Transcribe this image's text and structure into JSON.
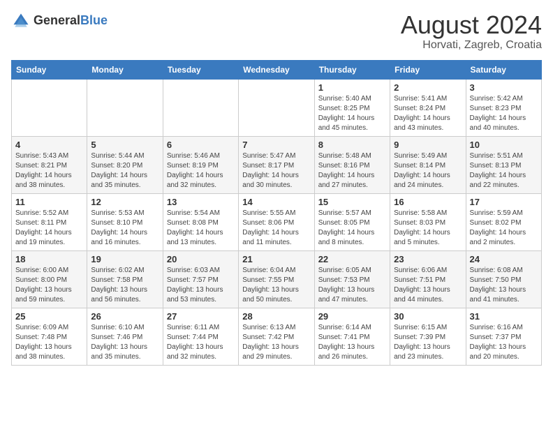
{
  "logo": {
    "general": "General",
    "blue": "Blue"
  },
  "title": "August 2024",
  "location": "Horvati, Zagreb, Croatia",
  "weekdays": [
    "Sunday",
    "Monday",
    "Tuesday",
    "Wednesday",
    "Thursday",
    "Friday",
    "Saturday"
  ],
  "weeks": [
    [
      {
        "day": "",
        "info": ""
      },
      {
        "day": "",
        "info": ""
      },
      {
        "day": "",
        "info": ""
      },
      {
        "day": "",
        "info": ""
      },
      {
        "day": "1",
        "info": "Sunrise: 5:40 AM\nSunset: 8:25 PM\nDaylight: 14 hours\nand 45 minutes."
      },
      {
        "day": "2",
        "info": "Sunrise: 5:41 AM\nSunset: 8:24 PM\nDaylight: 14 hours\nand 43 minutes."
      },
      {
        "day": "3",
        "info": "Sunrise: 5:42 AM\nSunset: 8:23 PM\nDaylight: 14 hours\nand 40 minutes."
      }
    ],
    [
      {
        "day": "4",
        "info": "Sunrise: 5:43 AM\nSunset: 8:21 PM\nDaylight: 14 hours\nand 38 minutes."
      },
      {
        "day": "5",
        "info": "Sunrise: 5:44 AM\nSunset: 8:20 PM\nDaylight: 14 hours\nand 35 minutes."
      },
      {
        "day": "6",
        "info": "Sunrise: 5:46 AM\nSunset: 8:19 PM\nDaylight: 14 hours\nand 32 minutes."
      },
      {
        "day": "7",
        "info": "Sunrise: 5:47 AM\nSunset: 8:17 PM\nDaylight: 14 hours\nand 30 minutes."
      },
      {
        "day": "8",
        "info": "Sunrise: 5:48 AM\nSunset: 8:16 PM\nDaylight: 14 hours\nand 27 minutes."
      },
      {
        "day": "9",
        "info": "Sunrise: 5:49 AM\nSunset: 8:14 PM\nDaylight: 14 hours\nand 24 minutes."
      },
      {
        "day": "10",
        "info": "Sunrise: 5:51 AM\nSunset: 8:13 PM\nDaylight: 14 hours\nand 22 minutes."
      }
    ],
    [
      {
        "day": "11",
        "info": "Sunrise: 5:52 AM\nSunset: 8:11 PM\nDaylight: 14 hours\nand 19 minutes."
      },
      {
        "day": "12",
        "info": "Sunrise: 5:53 AM\nSunset: 8:10 PM\nDaylight: 14 hours\nand 16 minutes."
      },
      {
        "day": "13",
        "info": "Sunrise: 5:54 AM\nSunset: 8:08 PM\nDaylight: 14 hours\nand 13 minutes."
      },
      {
        "day": "14",
        "info": "Sunrise: 5:55 AM\nSunset: 8:06 PM\nDaylight: 14 hours\nand 11 minutes."
      },
      {
        "day": "15",
        "info": "Sunrise: 5:57 AM\nSunset: 8:05 PM\nDaylight: 14 hours\nand 8 minutes."
      },
      {
        "day": "16",
        "info": "Sunrise: 5:58 AM\nSunset: 8:03 PM\nDaylight: 14 hours\nand 5 minutes."
      },
      {
        "day": "17",
        "info": "Sunrise: 5:59 AM\nSunset: 8:02 PM\nDaylight: 14 hours\nand 2 minutes."
      }
    ],
    [
      {
        "day": "18",
        "info": "Sunrise: 6:00 AM\nSunset: 8:00 PM\nDaylight: 13 hours\nand 59 minutes."
      },
      {
        "day": "19",
        "info": "Sunrise: 6:02 AM\nSunset: 7:58 PM\nDaylight: 13 hours\nand 56 minutes."
      },
      {
        "day": "20",
        "info": "Sunrise: 6:03 AM\nSunset: 7:57 PM\nDaylight: 13 hours\nand 53 minutes."
      },
      {
        "day": "21",
        "info": "Sunrise: 6:04 AM\nSunset: 7:55 PM\nDaylight: 13 hours\nand 50 minutes."
      },
      {
        "day": "22",
        "info": "Sunrise: 6:05 AM\nSunset: 7:53 PM\nDaylight: 13 hours\nand 47 minutes."
      },
      {
        "day": "23",
        "info": "Sunrise: 6:06 AM\nSunset: 7:51 PM\nDaylight: 13 hours\nand 44 minutes."
      },
      {
        "day": "24",
        "info": "Sunrise: 6:08 AM\nSunset: 7:50 PM\nDaylight: 13 hours\nand 41 minutes."
      }
    ],
    [
      {
        "day": "25",
        "info": "Sunrise: 6:09 AM\nSunset: 7:48 PM\nDaylight: 13 hours\nand 38 minutes."
      },
      {
        "day": "26",
        "info": "Sunrise: 6:10 AM\nSunset: 7:46 PM\nDaylight: 13 hours\nand 35 minutes."
      },
      {
        "day": "27",
        "info": "Sunrise: 6:11 AM\nSunset: 7:44 PM\nDaylight: 13 hours\nand 32 minutes."
      },
      {
        "day": "28",
        "info": "Sunrise: 6:13 AM\nSunset: 7:42 PM\nDaylight: 13 hours\nand 29 minutes."
      },
      {
        "day": "29",
        "info": "Sunrise: 6:14 AM\nSunset: 7:41 PM\nDaylight: 13 hours\nand 26 minutes."
      },
      {
        "day": "30",
        "info": "Sunrise: 6:15 AM\nSunset: 7:39 PM\nDaylight: 13 hours\nand 23 minutes."
      },
      {
        "day": "31",
        "info": "Sunrise: 6:16 AM\nSunset: 7:37 PM\nDaylight: 13 hours\nand 20 minutes."
      }
    ]
  ]
}
